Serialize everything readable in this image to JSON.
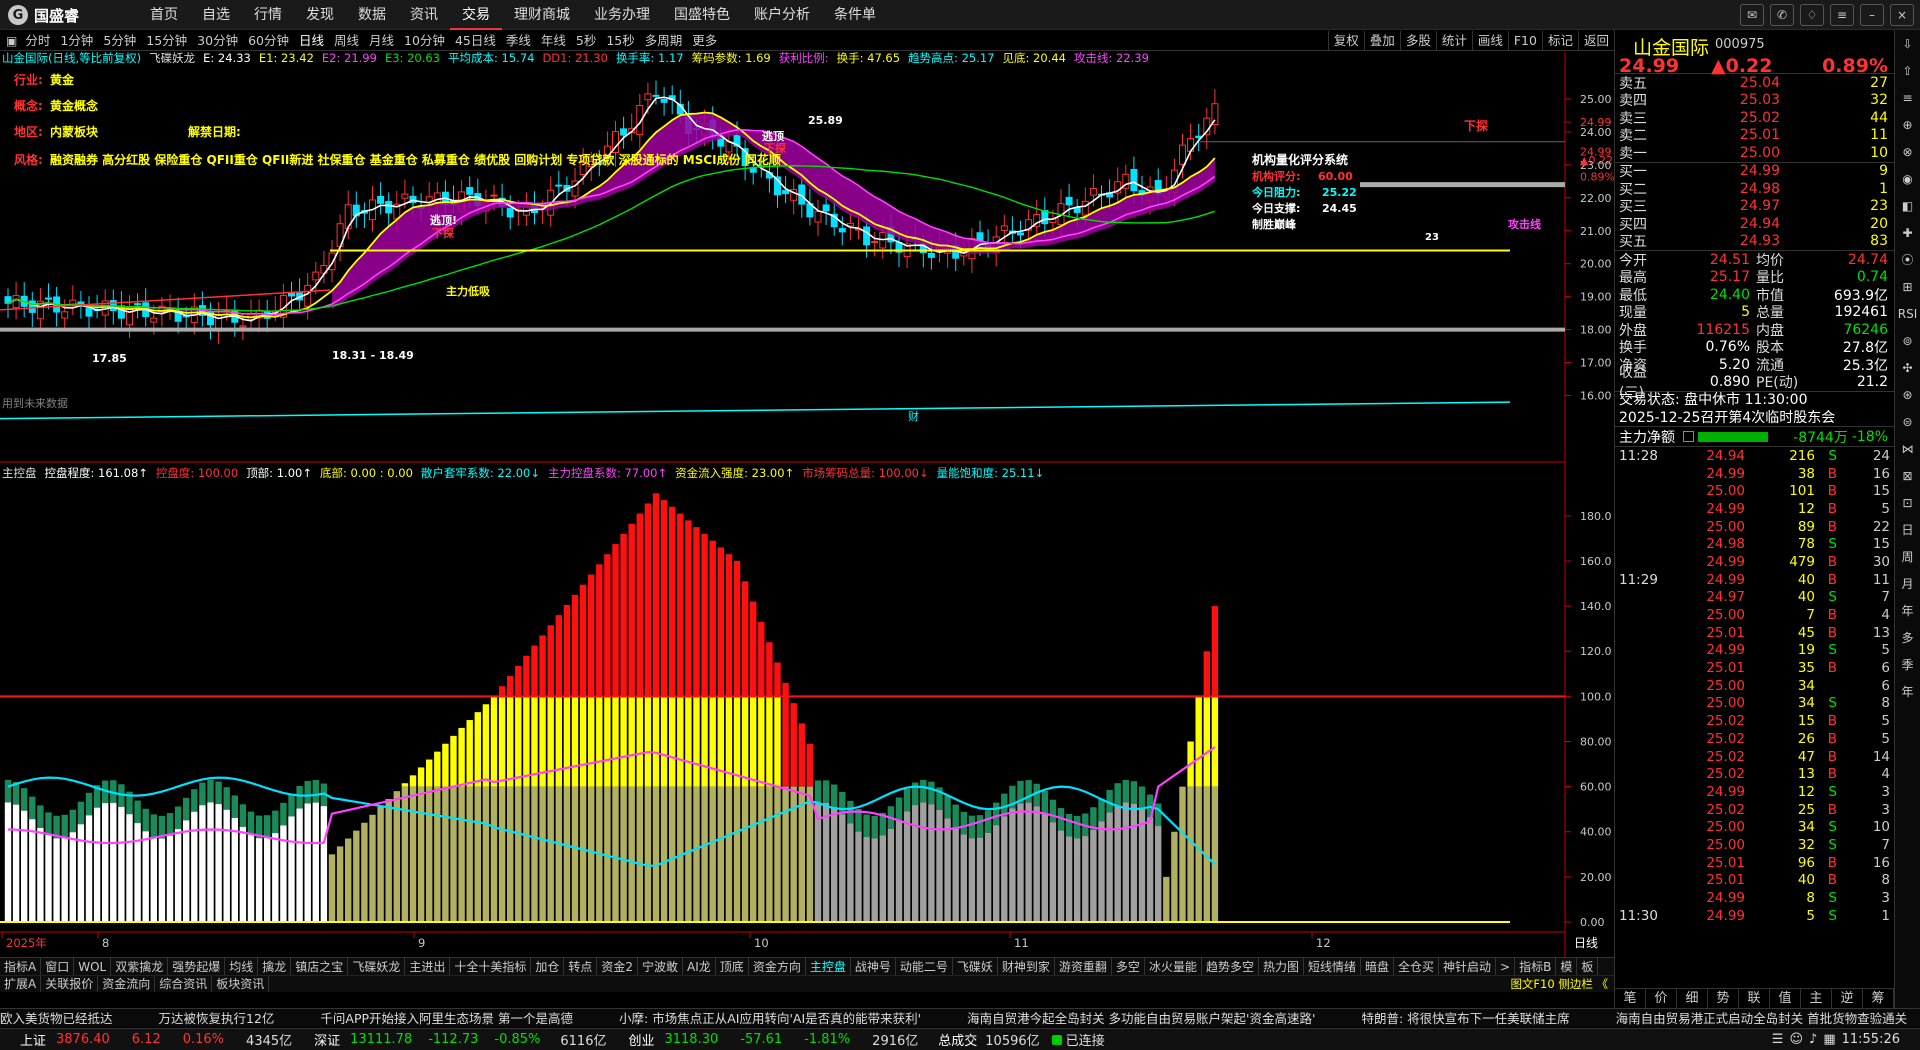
{
  "app": {
    "name": "国盛睿"
  },
  "nav": [
    "首页",
    "自选",
    "行情",
    "发现",
    "数据",
    "资讯",
    "交易",
    "理财商城",
    "业务办理",
    "国盛特色",
    "账户分析",
    "条件单"
  ],
  "nav_active": 6,
  "window_icons": [
    "message-icon",
    "mail-icon",
    "skin-icon",
    "menu-icon",
    "minimize-icon",
    "close-icon"
  ],
  "periods": [
    "分时",
    "1分钟",
    "5分钟",
    "15分钟",
    "30分钟",
    "60分钟",
    "日线",
    "周线",
    "月线",
    "10分钟",
    "45日线",
    "季线",
    "年线",
    "5秒",
    "15秒",
    "多周期",
    "更多"
  ],
  "period_active": 6,
  "toolbar": [
    "复权",
    "叠加",
    "多股",
    "统计",
    "画线",
    "F10",
    "标记",
    "返回"
  ],
  "main_legend": [
    {
      "t": "山金国际(日线,等比前复权)",
      "c": "#00ffff"
    },
    {
      "t": "飞碟妖龙",
      "c": "#dddddd"
    },
    {
      "t": "E: 24.33",
      "c": "#ffffff"
    },
    {
      "t": "E1: 23.42",
      "c": "#ffff00"
    },
    {
      "t": "E2: 21.99",
      "c": "#ff40ff"
    },
    {
      "t": "E3: 20.63",
      "c": "#00e000"
    },
    {
      "t": "平均成本: 15.74",
      "c": "#00ffff"
    },
    {
      "t": "DD1: 21.30",
      "c": "#ff3232"
    },
    {
      "t": "换手率: 1.17",
      "c": "#00ffff"
    },
    {
      "t": "筹码参数: 1.69",
      "c": "#ffff00"
    },
    {
      "t": "获利比例:",
      "c": "#ff40ff"
    },
    {
      "t": "换手: 47.65",
      "c": "#ffff00"
    },
    {
      "t": "趋势高点: 25.17",
      "c": "#00ffff"
    },
    {
      "t": "见底: 20.44",
      "c": "#ffff00"
    },
    {
      "t": "攻击线: 22.39",
      "c": "#ff40ff"
    }
  ],
  "info": {
    "industry_label": "行业:",
    "industry": "黄金",
    "concept_label": "概念:",
    "concept": "黄金概念",
    "region_label": "地区:",
    "region": "内蒙板块",
    "unlock_label": "解禁日期:",
    "style_label": "风格:",
    "style": "融资融券 高分红股 保险重仓 QFII重仓 QFII新进 社保重仓 基金重仓 私募重仓 绩优股 回购计划 专项贷款 深股通标的 MSCI成份 同花顺"
  },
  "eval": {
    "title": "机构量化评分系统",
    "score_label": "机构评分:",
    "score": "60.00",
    "press_label": "今日阻力:",
    "press": "25.22",
    "support_label": "今日支撑:",
    "support": "24.45",
    "note": "制胜巅峰"
  },
  "annotations": {
    "escape1": "逃顶!",
    "drop1": "下探",
    "escape2": "逃顶",
    "drop2": "下探",
    "drop3": "下探",
    "main_lowsuck": "主力低吸",
    "high_label": "25.89",
    "low_label": "17.85",
    "range_label": "18.31 - 18.49",
    "attack": "攻击线",
    "note_23": "23",
    "no_data": "用到未来数据",
    "finance": "财"
  },
  "price_axis": [
    "25.00",
    "24.99",
    "24.00",
    "23.00",
    "22.00",
    "21.00",
    "20.00",
    "19.00",
    "18.00",
    "17.00",
    "16.00"
  ],
  "price_axis_right": {
    "price": "24.99",
    "chg": "▲0.22",
    "pct": "0.89%"
  },
  "sub_legend": [
    {
      "t": "主控盘",
      "c": "#dddddd"
    },
    {
      "t": "控盘程度: 161.08↑",
      "c": "#ffffff"
    },
    {
      "t": "控盘度: 100.00",
      "c": "#ff3232"
    },
    {
      "t": "顶部: 1.00↑",
      "c": "#ffffff"
    },
    {
      "t": "底部: 0.00 : 0.00",
      "c": "#ffff00"
    },
    {
      "t": "散户套牢系数: 22.00↓",
      "c": "#00ffff"
    },
    {
      "t": "主力控盘系数: 77.00↑",
      "c": "#ff40ff"
    },
    {
      "t": "资金流入强度: 23.00↑",
      "c": "#ffff00"
    },
    {
      "t": "市场筹码总量: 100.00↓",
      "c": "#ff3232"
    },
    {
      "t": "量能饱和度: 25.11↓",
      "c": "#00ffff"
    }
  ],
  "sub_axis": [
    "180.0",
    "160.0",
    "140.0",
    "120.0",
    "100.0",
    "80.00",
    "60.00",
    "40.00",
    "20.00",
    "0.00"
  ],
  "date_axis": [
    "2025年",
    "8",
    "9",
    "10",
    "11",
    "12"
  ],
  "day_label": "日线",
  "tabs1": [
    "指标A",
    "窗口",
    "WOL",
    "双紫擒龙",
    "强势起爆",
    "均线",
    "擒龙",
    "镇店之宝",
    "飞碟妖龙",
    "主进出",
    "十全十美指标",
    "加仓",
    "转点",
    "资金2",
    "宁波敢",
    "AI龙",
    "顶底",
    "资金方向",
    "主控盘",
    "战神号",
    "动能二号",
    "飞碟妖",
    "财神到家",
    "游资重翻",
    "多空",
    "冰火量能",
    "趋势多空",
    "热力图",
    "短线情绪",
    "暗盘",
    "全仓买",
    "神针启动",
    ">",
    "指标B",
    "模",
    "板"
  ],
  "tabs1_active": 18,
  "tabs2": [
    "扩展A",
    "关联报价",
    "资金流向",
    "综合资讯",
    "板块资讯"
  ],
  "tabs2_right": "图文F10 侧边栏 《",
  "quote": {
    "name": "山金国际",
    "code": "000975",
    "price": "24.99",
    "chg": "▲0.22",
    "pct": "0.89%",
    "asks": [
      {
        "l": "卖五",
        "p": "25.04",
        "v": "27"
      },
      {
        "l": "卖四",
        "p": "25.03",
        "v": "32"
      },
      {
        "l": "卖三",
        "p": "25.02",
        "v": "44"
      },
      {
        "l": "卖二",
        "p": "25.01",
        "v": "11"
      },
      {
        "l": "卖一",
        "p": "25.00",
        "v": "10"
      }
    ],
    "bids": [
      {
        "l": "买一",
        "p": "24.99",
        "v": "9"
      },
      {
        "l": "买二",
        "p": "24.98",
        "v": "1"
      },
      {
        "l": "买三",
        "p": "24.97",
        "v": "23"
      },
      {
        "l": "买四",
        "p": "24.94",
        "v": "20"
      },
      {
        "l": "买五",
        "p": "24.93",
        "v": "83"
      }
    ],
    "stats": [
      {
        "l": "今开",
        "v": "24.51",
        "c1": "r",
        "l2": "均价",
        "v2": "24.74",
        "c2": "r"
      },
      {
        "l": "最高",
        "v": "25.17",
        "c1": "r",
        "l2": "量比",
        "v2": "0.74",
        "c2": "g"
      },
      {
        "l": "最低",
        "v": "24.40",
        "c1": "g",
        "l2": "市值",
        "v2": "693.9亿",
        "c2": "w"
      },
      {
        "l": "现量",
        "v": "5",
        "c1": "y",
        "l2": "总量",
        "v2": "192461",
        "c2": "w"
      },
      {
        "l": "外盘",
        "v": "116215",
        "c1": "r",
        "l2": "内盘",
        "v2": "76246",
        "c2": "g"
      },
      {
        "l": "换手",
        "v": "0.76%",
        "c1": "w",
        "l2": "股本",
        "v2": "27.8亿",
        "c2": "w"
      },
      {
        "l": "净资",
        "v": "5.20",
        "c1": "w",
        "l2": "流通",
        "v2": "25.3亿",
        "c2": "w"
      },
      {
        "l": "收益(三)",
        "v": "0.890",
        "c1": "w",
        "l2": "PE(动)",
        "v2": "21.2",
        "c2": "w"
      }
    ],
    "trade_status": "交易状态: 盘中休市 11:30:00",
    "meeting": "2025-12-25召开第4次临时股东会",
    "flow_label": "主力净额",
    "flow_val": "-8744万",
    "flow_pct": "-18%",
    "ticks": [
      {
        "t": "11:28",
        "p": "24.94",
        "v": "216",
        "d": "S",
        "n": "24",
        "pc": "r"
      },
      {
        "t": "",
        "p": "24.99",
        "v": "38",
        "d": "B",
        "n": "16",
        "pc": "r"
      },
      {
        "t": "",
        "p": "25.00",
        "v": "101",
        "d": "B",
        "n": "15",
        "pc": "r"
      },
      {
        "t": "",
        "p": "24.99",
        "v": "12",
        "d": "B",
        "n": "5",
        "pc": "r"
      },
      {
        "t": "",
        "p": "25.00",
        "v": "89",
        "d": "B",
        "n": "22",
        "pc": "r"
      },
      {
        "t": "",
        "p": "24.98",
        "v": "78",
        "d": "S",
        "n": "15",
        "pc": "r"
      },
      {
        "t": "",
        "p": "24.99",
        "v": "479",
        "d": "B",
        "n": "30",
        "pc": "r"
      },
      {
        "t": "11:29",
        "p": "24.99",
        "v": "40",
        "d": "B",
        "n": "11",
        "pc": "r"
      },
      {
        "t": "",
        "p": "24.97",
        "v": "40",
        "d": "S",
        "n": "7",
        "pc": "r"
      },
      {
        "t": "",
        "p": "25.00",
        "v": "7",
        "d": "B",
        "n": "4",
        "pc": "r"
      },
      {
        "t": "",
        "p": "25.01",
        "v": "45",
        "d": "B",
        "n": "13",
        "pc": "r"
      },
      {
        "t": "",
        "p": "24.99",
        "v": "19",
        "d": "S",
        "n": "5",
        "pc": "r"
      },
      {
        "t": "",
        "p": "25.01",
        "v": "35",
        "d": "B",
        "n": "6",
        "pc": "r"
      },
      {
        "t": "",
        "p": "25.00",
        "v": "34",
        "d": "",
        "n": "6",
        "pc": "r"
      },
      {
        "t": "",
        "p": "25.00",
        "v": "34",
        "d": "S",
        "n": "8",
        "pc": "r"
      },
      {
        "t": "",
        "p": "25.02",
        "v": "15",
        "d": "B",
        "n": "5",
        "pc": "r"
      },
      {
        "t": "",
        "p": "25.02",
        "v": "26",
        "d": "B",
        "n": "5",
        "pc": "r"
      },
      {
        "t": "",
        "p": "25.02",
        "v": "47",
        "d": "B",
        "n": "14",
        "pc": "r"
      },
      {
        "t": "",
        "p": "25.02",
        "v": "13",
        "d": "B",
        "n": "4",
        "pc": "r"
      },
      {
        "t": "",
        "p": "24.99",
        "v": "12",
        "d": "S",
        "n": "3",
        "pc": "r"
      },
      {
        "t": "",
        "p": "25.02",
        "v": "25",
        "d": "B",
        "n": "3",
        "pc": "r"
      },
      {
        "t": "",
        "p": "25.00",
        "v": "34",
        "d": "S",
        "n": "10",
        "pc": "r"
      },
      {
        "t": "",
        "p": "25.00",
        "v": "32",
        "d": "S",
        "n": "7",
        "pc": "r"
      },
      {
        "t": "",
        "p": "25.01",
        "v": "96",
        "d": "B",
        "n": "16",
        "pc": "r"
      },
      {
        "t": "",
        "p": "25.01",
        "v": "40",
        "d": "B",
        "n": "8",
        "pc": "r"
      },
      {
        "t": "",
        "p": "24.99",
        "v": "8",
        "d": "S",
        "n": "3",
        "pc": "r"
      },
      {
        "t": "11:30",
        "p": "24.99",
        "v": "5",
        "d": "S",
        "n": "1",
        "pc": "r"
      }
    ],
    "bottom_tabs": [
      "笔",
      "价",
      "细",
      "势",
      "联",
      "值",
      "主",
      "逆",
      "筹"
    ]
  },
  "sidebar_items": [
    "⇩",
    "⇧",
    "≡",
    "⊕",
    "⊗",
    "◉",
    "◧",
    "✚",
    "⦿",
    "⊞",
    "RSI",
    "⊚",
    "✣",
    "⊛",
    "⊜",
    "⋈",
    "⊠",
    "⊡",
    "日",
    "周",
    "月",
    "年",
    "多",
    "季",
    "年"
  ],
  "news": [
    "欧入美货物已经抵达",
    "万达被恢复执行12亿",
    "千问APP开始接入阿里生态场景 第一个是高德",
    "小摩: 市场焦点正从AI应用转向'AI是否真的能带来获利'",
    "海南自贸港今起全岛封关 多功能自由贸易账户架起'资金高速路'",
    "特朗普: 将很快宣布下一任美联储主席",
    "海南自由贸易港正式启动全岛封关 首批货物查验通关"
  ],
  "status": {
    "sh_label": "上证",
    "sh": "3876.40",
    "sh_chg": "6.12",
    "sh_pct": "0.16%",
    "sh_amt": "4345亿",
    "sz_label": "深证",
    "sz": "13111.78",
    "sz_chg": "-112.73",
    "sz_pct": "-0.85%",
    "sz_amt": "6116亿",
    "cy_label": "创业",
    "cy": "3118.30",
    "cy_chg": "-57.61",
    "cy_pct": "-1.81%",
    "cy_amt": "2916亿",
    "total_label": "总成交",
    "total": "10596亿",
    "conn": "已连接",
    "time": "11:55:26"
  },
  "chart_data": [
    {
      "type": "candlestick",
      "ylim": [
        15.5,
        26.0
      ],
      "series": [
        {
          "name": "E",
          "color": "#ffffff"
        },
        {
          "name": "E1",
          "color": "#ffff00"
        },
        {
          "name": "E2",
          "color": "#ff40ff"
        },
        {
          "name": "E3",
          "color": "#00e000"
        }
      ]
    },
    {
      "type": "bar",
      "ylim": [
        0,
        195
      ],
      "reference_line": 100,
      "series": [
        {
          "name": "控盘程度",
          "color": "#ff3232"
        },
        {
          "name": "散户套牢系数",
          "color": "#00ffff"
        },
        {
          "name": "主力控盘系数",
          "color": "#ff40ff"
        }
      ]
    }
  ]
}
